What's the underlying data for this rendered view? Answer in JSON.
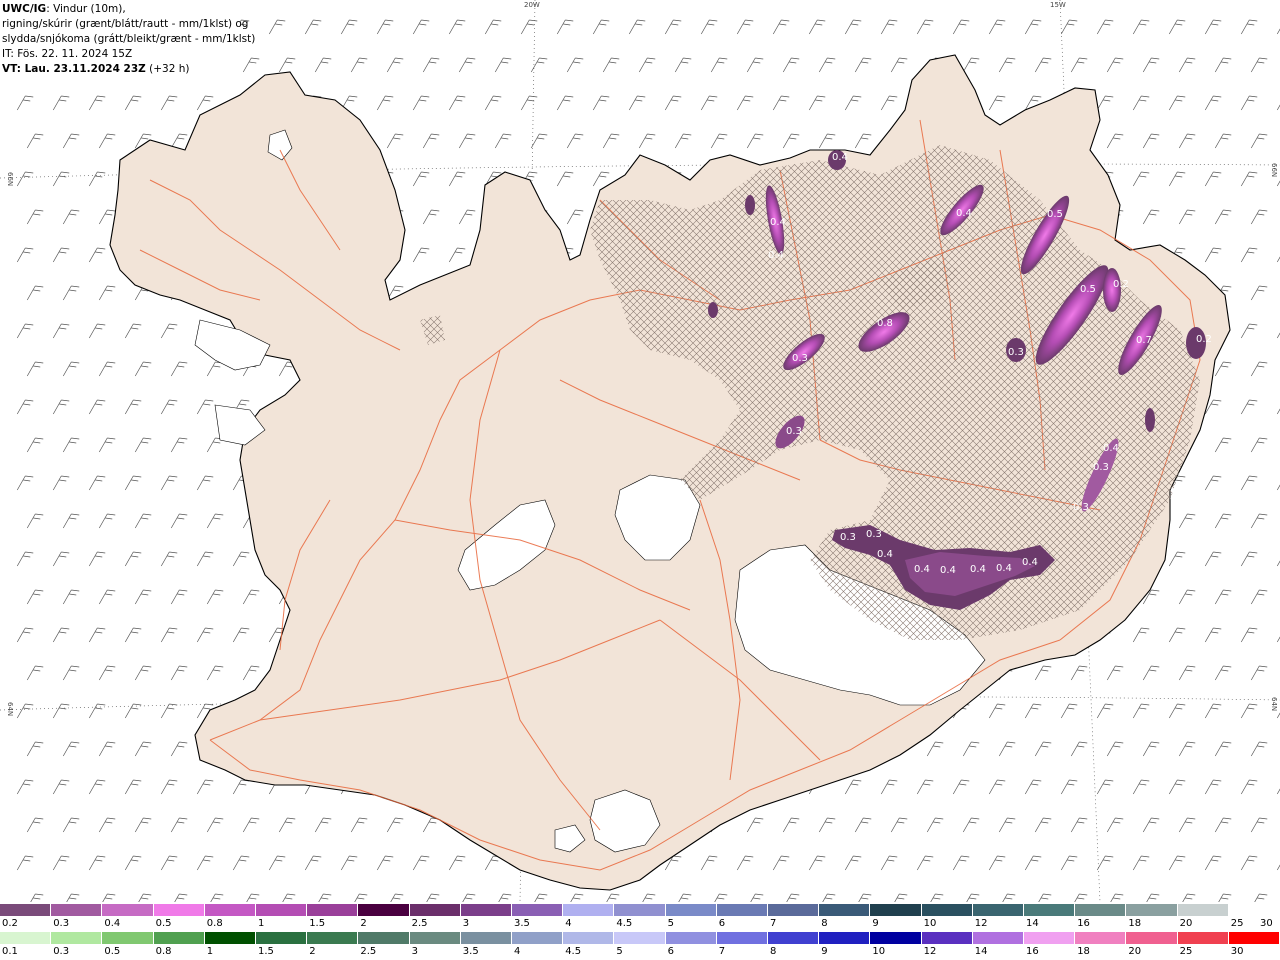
{
  "title": {
    "product": "UWC/IG",
    "description": ": Vindur (10m),",
    "line2": "rigning/skúrir (grænt/blátt/rautt - mm/1klst) og",
    "line3": "slydda/snjókoma (grátt/bleikt/grænt - mm/1klst)",
    "init_time": "IT: Fös. 22. 11. 2024 15Z",
    "valid_label": "VT: Lau. 23.11.2024 23Z",
    "valid_offset": " (+32 h)"
  },
  "coordinates": {
    "lon_20w": "20W",
    "lon_15w": "15W",
    "lat_66n_left": "66N",
    "lat_66n_right": "66N",
    "lat_64n_left": "64N",
    "lat_64n_right": "64N"
  },
  "map_values": [
    "0.4",
    "0.3",
    "0.4",
    "0.3",
    "0.3",
    "0.4",
    "0.4",
    "0.4",
    "0.4",
    "0.4",
    "0.4",
    "0.3",
    "0.3",
    "0.4",
    "0.5",
    "0.8",
    "0.2",
    "0.7",
    "0.2",
    "0.3",
    "0.3",
    "0.4",
    "0.4",
    "0.5"
  ],
  "colorbar_snow": {
    "colors": [
      "#7a4b7a",
      "#a15aa0",
      "#c66bc4",
      "#f07ae8",
      "#c458c4",
      "#b44db4",
      "#9a3f9a",
      "#4a0040",
      "#6b2f6b",
      "#7b3e8a",
      "#8a5fb4",
      "#b0b0f0",
      "#9090d0",
      "#7a8ac8",
      "#6a7ab4",
      "#5a6a9a",
      "#3a5a78",
      "#20404e",
      "#2a5060",
      "#3a6570",
      "#4a7a7a",
      "#6a8a88",
      "#8aa0a0",
      "#c8d0d0",
      "#ffffff"
    ],
    "labels": [
      "0.2",
      "0.3",
      "0.4",
      "0.5",
      "0.8",
      "1",
      "1.5",
      "2",
      "2.5",
      "3",
      "3.5",
      "4",
      "4.5",
      "5",
      "6",
      "7",
      "8",
      "9",
      "10",
      "12",
      "14",
      "16",
      "18",
      "20",
      "25",
      "30"
    ]
  },
  "colorbar_rain": {
    "colors": [
      "#d8f5d0",
      "#b0e8a0",
      "#80c870",
      "#50a050",
      "#005000",
      "#2a7040",
      "#3a7a50",
      "#507a68",
      "#6a8a80",
      "#7a90a0",
      "#90a0c8",
      "#b0b8e8",
      "#c8c8f8",
      "#9090e0",
      "#7070e0",
      "#4040d0",
      "#2020c0",
      "#0000a0",
      "#5a30c0",
      "#b070e0",
      "#f0a0f0",
      "#f080c0",
      "#f06090",
      "#f04050",
      "#ff0000"
    ],
    "labels": [
      "0.1",
      "0.3",
      "0.5",
      "0.8",
      "1",
      "1.5",
      "2",
      "2.5",
      "3",
      "3.5",
      "4",
      "4.5",
      "5",
      "6",
      "7",
      "8",
      "9",
      "10",
      "12",
      "14",
      "16",
      "18",
      "20",
      "25",
      "30"
    ]
  }
}
